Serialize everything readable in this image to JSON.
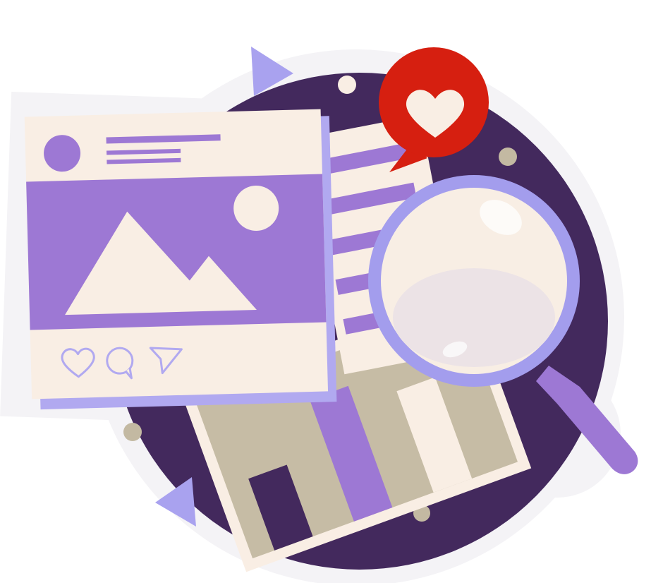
{
  "illustration": {
    "colors": {
      "background": "#ffffff",
      "sticker_outline": "#f4f3f6",
      "circle_backdrop": "#43295d",
      "post_card": "#f9eee4",
      "post_card_edge": "#b1a9f0",
      "accent_purple": "#9d78d4",
      "triangle_lavender": "#a9a2ef",
      "heart_bubble_red": "#d61f10",
      "heart_cream": "#f9eee4",
      "dot_khaki": "#c3b9a2",
      "chart_paper": "#f9eee4",
      "chart_panel": "#c6bca5",
      "bar_dark": "#43295d",
      "bar_purple": "#9d78d4",
      "bar_cream": "#f9eee4",
      "magnifier_rim": "#a39ded",
      "magnifier_handle": "#9d78d4",
      "lens": "#f8eee4"
    },
    "icons": [
      "heart-icon",
      "comment-icon",
      "send-icon",
      "mountain-image-icon",
      "magnifying-glass-icon",
      "bar-chart-icon"
    ],
    "chart_bar_levels": [
      0.46,
      0.78,
      0.65
    ]
  }
}
